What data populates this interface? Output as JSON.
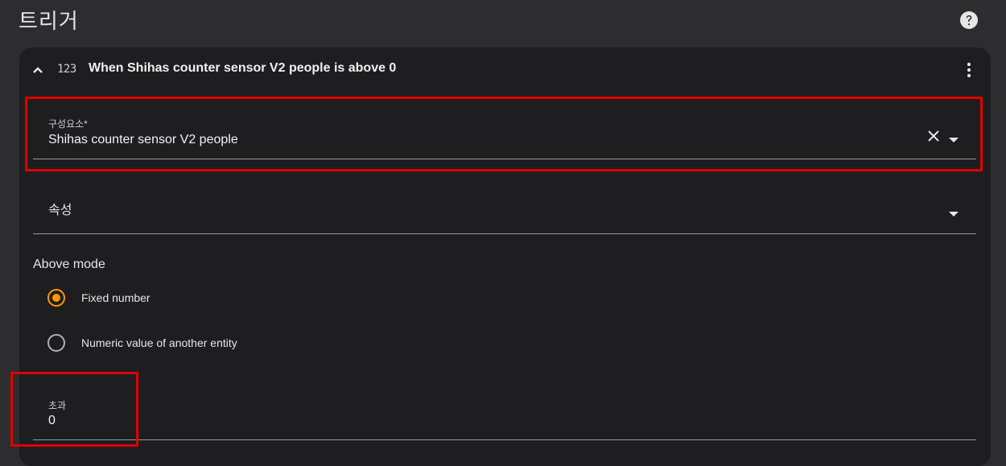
{
  "page": {
    "title": "트리거"
  },
  "card": {
    "type_icon": "numeric-123-icon",
    "title": "When Shihas counter sensor V2 people is above 0"
  },
  "entity_field": {
    "label": "구성요소*",
    "value": "Shihas counter sensor V2 people"
  },
  "attribute_field": {
    "label": "속성"
  },
  "above_mode": {
    "title": "Above mode",
    "options": [
      {
        "label": "Fixed number",
        "selected": true
      },
      {
        "label": "Numeric value of another entity",
        "selected": false
      }
    ]
  },
  "above_field": {
    "label": "초과",
    "value": "0"
  },
  "colors": {
    "background": "#2d2d2f",
    "card": "#1e1e20",
    "accent": "#ff9800",
    "highlight": "#e10000"
  },
  "icons": [
    "help-circle-icon",
    "chevron-up-icon",
    "numeric-123-icon",
    "more-vertical-icon",
    "close-icon",
    "chevron-down-icon"
  ]
}
